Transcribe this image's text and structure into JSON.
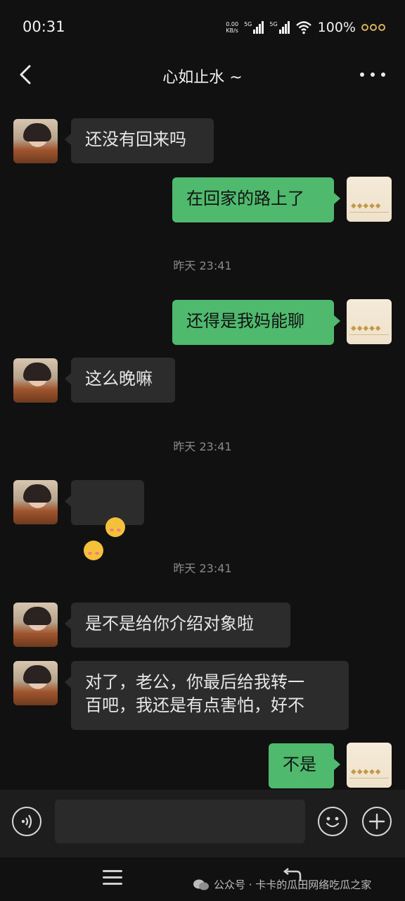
{
  "status": {
    "time": "00:31",
    "net_speed_value": "0.00",
    "net_speed_unit": "KB/s",
    "signal1": "5G",
    "signal2": "5G",
    "battery": "100%"
  },
  "header": {
    "title": "心如止水 ~"
  },
  "messages": [
    {
      "from": "her",
      "text": "还没有回来吗"
    },
    {
      "from": "me",
      "text": "在回家的路上了"
    },
    {
      "type": "time",
      "text": "昨天 23:41"
    },
    {
      "from": "me",
      "text": "还得是我妈能聊"
    },
    {
      "from": "her",
      "text": "这么晚嘛"
    },
    {
      "type": "time",
      "text": "昨天 23:41"
    },
    {
      "from": "her",
      "emoji": [
        "blush-face-emoji",
        "blush-face-emoji"
      ]
    },
    {
      "type": "time",
      "text": "昨天 23:41"
    },
    {
      "from": "her",
      "text": "是不是给你介绍对象啦"
    },
    {
      "from": "her",
      "text": "对了，老公，你最后给我转一\n百吧，我还是有点害怕，好不"
    },
    {
      "from": "me",
      "text": "不是"
    }
  ],
  "input": {
    "value": ""
  },
  "watermark": {
    "text": "公众号 · 卡卡的瓜田网络吃瓜之家"
  },
  "colors": {
    "background": "#111111",
    "incoming_bubble": "#2c2c2c",
    "outgoing_bubble": "#4fba6d",
    "timestamp": "#8a8a8a"
  }
}
